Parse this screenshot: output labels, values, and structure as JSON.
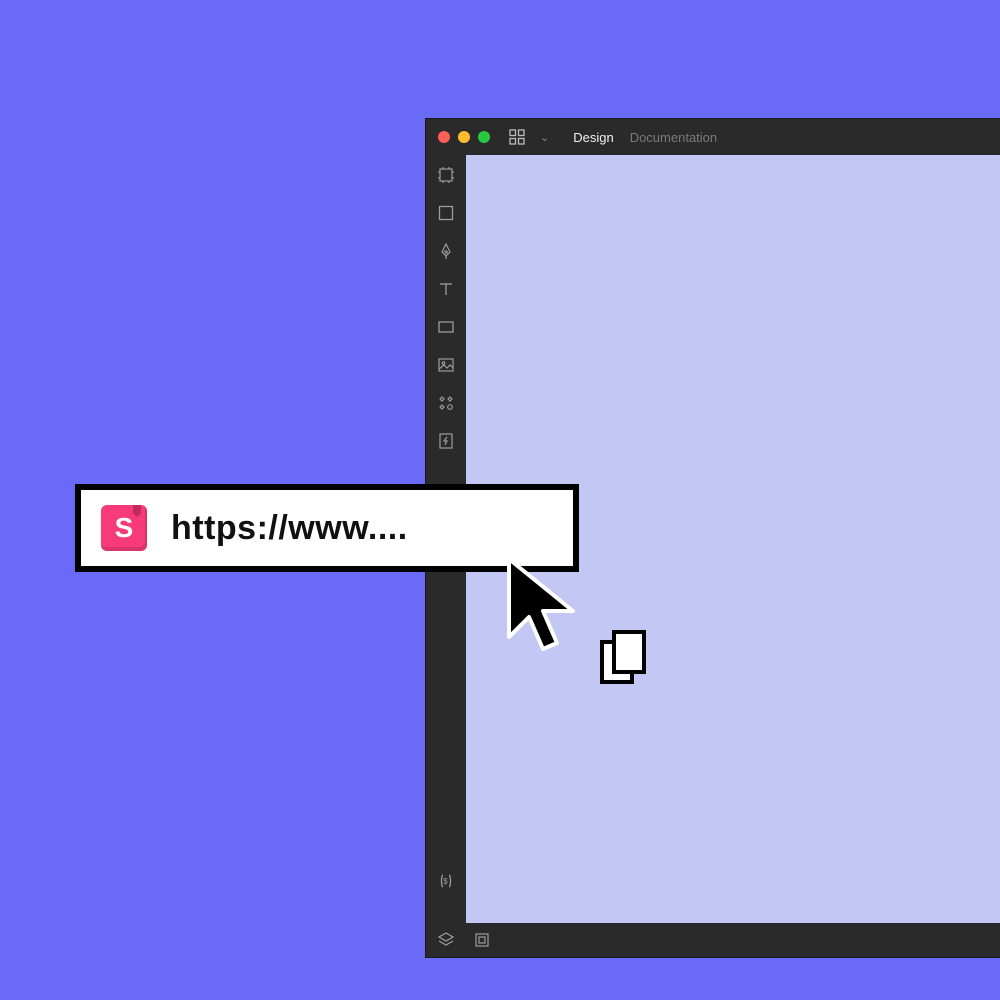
{
  "colors": {
    "page_bg": "#6A6AF8",
    "window_bg": "#2A2A2A",
    "canvas_bg": "#C3C7F4",
    "accent_pink": "#F73B7A"
  },
  "titlebar": {
    "traffic_lights": {
      "close": "#FF5F57",
      "minimize": "#FEBC2E",
      "maximize": "#28C840"
    },
    "tabs": [
      {
        "label": "Design",
        "active": true
      },
      {
        "label": "Documentation",
        "active": false
      }
    ],
    "apps_button_icon": "grid-apps-icon",
    "dropdown_icon": "chevron-down-icon"
  },
  "tools": [
    {
      "name": "artboard-tool"
    },
    {
      "name": "rectangle-tool"
    },
    {
      "name": "pen-tool"
    },
    {
      "name": "text-tool"
    },
    {
      "name": "frame-tool"
    },
    {
      "name": "image-tool"
    },
    {
      "name": "components-tool"
    },
    {
      "name": "bolt-tool"
    }
  ],
  "bottom_tools": [
    {
      "name": "variables-tool"
    },
    {
      "name": "layers-tool"
    },
    {
      "name": "assets-tool"
    }
  ],
  "url_input": {
    "badge_letter": "S",
    "value": "https://www...."
  },
  "cursor": {
    "icon": "cursor-arrow-icon"
  },
  "drag_hint": {
    "icon": "copy-pages-icon"
  }
}
